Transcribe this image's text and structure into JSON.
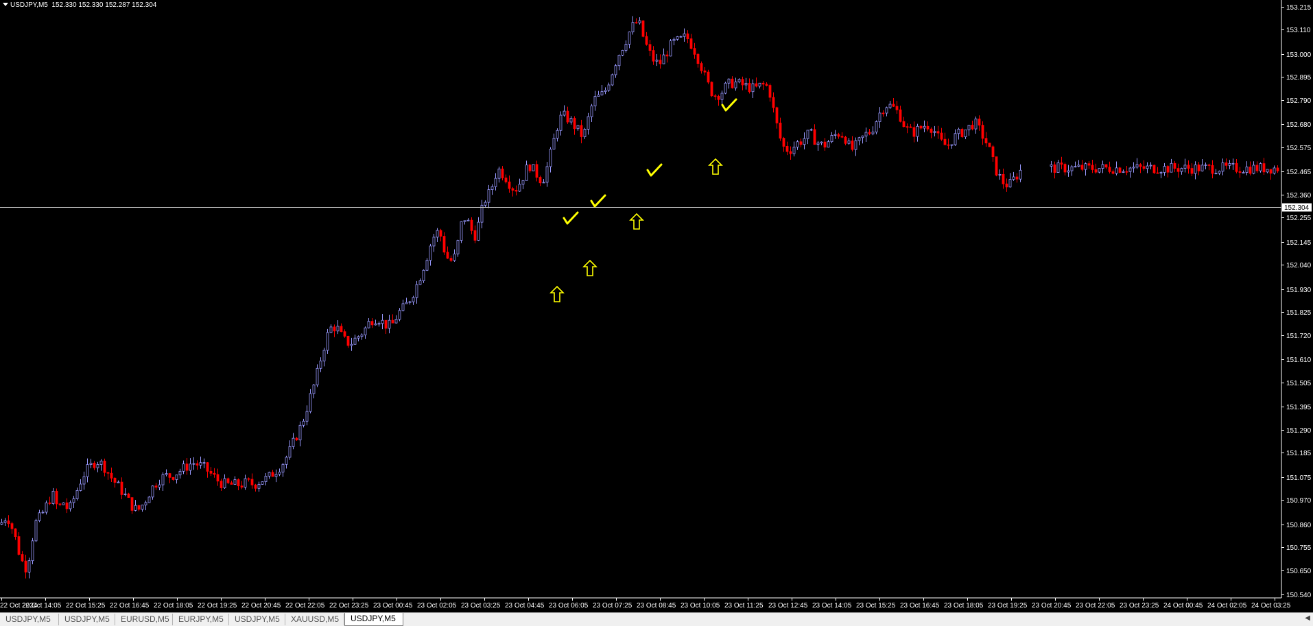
{
  "header": {
    "symbol_tf": "USDJPY,M5",
    "ohlc": "152.330 152.330 152.287 152.304"
  },
  "colors": {
    "background": "#000000",
    "bull": "#9999ff",
    "bear": "#ff0000",
    "axis": "#ffffff",
    "annotation": "#ffff00",
    "price_line": "#c0c0c0"
  },
  "chart_data": {
    "type": "candlestick",
    "symbol": "USDJPY",
    "timeframe": "M5",
    "current_price": "152.304",
    "y_ticks": [
      "153.215",
      "153.110",
      "153.000",
      "152.895",
      "152.790",
      "152.680",
      "152.575",
      "152.465",
      "152.360",
      "152.255",
      "152.145",
      "152.040",
      "151.930",
      "151.825",
      "151.720",
      "151.610",
      "151.505",
      "151.395",
      "151.290",
      "151.185",
      "151.075",
      "150.970",
      "150.860",
      "150.755",
      "150.650",
      "150.540"
    ],
    "x_ticks": [
      "22 Oct 2024",
      "22 Oct 14:05",
      "22 Oct 15:25",
      "22 Oct 16:45",
      "22 Oct 18:05",
      "22 Oct 19:25",
      "22 Oct 20:45",
      "22 Oct 22:05",
      "22 Oct 23:25",
      "23 Oct 00:45",
      "23 Oct 02:05",
      "23 Oct 03:25",
      "23 Oct 04:45",
      "23 Oct 06:05",
      "23 Oct 07:25",
      "23 Oct 08:45",
      "23 Oct 10:05",
      "23 Oct 11:25",
      "23 Oct 12:45",
      "23 Oct 14:05",
      "23 Oct 15:25",
      "23 Oct 16:45",
      "23 Oct 18:05",
      "23 Oct 19:25",
      "23 Oct 20:45",
      "23 Oct 22:05",
      "23 Oct 23:25",
      "24 Oct 00:45",
      "24 Oct 02:05",
      "24 Oct 03:25"
    ],
    "ylim": [
      150.525,
      153.245
    ],
    "path_x": [
      0,
      10,
      20,
      30,
      38,
      44,
      50,
      60,
      68,
      76,
      84,
      92,
      100,
      110,
      120,
      130,
      140,
      150,
      160,
      170,
      180,
      190,
      200,
      210,
      220,
      230,
      240,
      250,
      260,
      270,
      280,
      290,
      300,
      310,
      320,
      330,
      340,
      350,
      360,
      370,
      380,
      390,
      400,
      410,
      420,
      430,
      440,
      450,
      460,
      470,
      480,
      490,
      500,
      510,
      520,
      530,
      540,
      550,
      560,
      570,
      580,
      590,
      600,
      610,
      620,
      630,
      640,
      645,
      650,
      655,
      660,
      665,
      670,
      675,
      680,
      685,
      690,
      695,
      700,
      705,
      710,
      715,
      720,
      725,
      730,
      735,
      740,
      745,
      750,
      755,
      760,
      765,
      770,
      775,
      780,
      785,
      790,
      795,
      800,
      805,
      810,
      815,
      820,
      825,
      830,
      835,
      840,
      845,
      850,
      855,
      860,
      865,
      870,
      875,
      880,
      890,
      900,
      910,
      920,
      930,
      940,
      950,
      960,
      970,
      980,
      990,
      1000,
      1010,
      1020,
      1030,
      1040,
      1050,
      1060,
      1070,
      1080,
      1090,
      1100,
      1110,
      1120,
      1130,
      1140,
      1150,
      1160,
      1170,
      1180,
      1190,
      1200,
      1210,
      1220,
      1230,
      1240,
      1250,
      1260,
      1270,
      1280,
      1290,
      1300,
      1310,
      1320,
      1330,
      1340,
      1350,
      1360,
      1370,
      1380,
      1390,
      1400,
      1410,
      1420,
      1430,
      1440,
      1450,
      1460,
      1470,
      1480,
      1490,
      1500,
      1510,
      1520,
      1525
    ],
    "path_close": [
      150.86,
      150.9,
      150.82,
      150.7,
      150.66,
      150.74,
      150.86,
      150.9,
      150.95,
      151.0,
      150.93,
      150.96,
      150.92,
      151.0,
      151.08,
      151.12,
      151.15,
      151.13,
      151.08,
      151.04,
      151.0,
      150.95,
      150.92,
      150.96,
      151.02,
      151.06,
      151.08,
      151.08,
      151.1,
      151.12,
      151.14,
      151.13,
      151.11,
      151.08,
      151.05,
      151.04,
      151.04,
      151.04,
      151.05,
      151.04,
      151.06,
      151.07,
      151.1,
      151.13,
      151.18,
      151.25,
      151.32,
      151.42,
      151.52,
      151.65,
      151.75,
      151.76,
      151.7,
      151.68,
      151.71,
      151.74,
      151.79,
      151.8,
      151.77,
      151.76,
      151.82,
      151.85,
      151.9,
      151.97,
      152.06,
      152.16,
      152.2,
      152.13,
      152.08,
      152.06,
      152.06,
      152.1,
      152.2,
      152.26,
      152.24,
      152.22,
      152.16,
      152.2,
      152.26,
      152.33,
      152.35,
      152.38,
      152.43,
      152.48,
      152.46,
      152.45,
      152.42,
      152.4,
      152.38,
      152.4,
      152.43,
      152.46,
      152.5,
      152.48,
      152.46,
      152.44,
      152.42,
      152.46,
      152.52,
      152.58,
      152.65,
      152.7,
      152.72,
      152.71,
      152.7,
      152.68,
      152.66,
      152.64,
      152.62,
      152.68,
      152.74,
      152.79,
      152.8,
      152.81,
      152.82,
      152.9,
      152.99,
      153.05,
      153.12,
      153.15,
      153.05,
      152.98,
      152.95,
      153.0,
      153.05,
      153.06,
      153.08,
      153.03,
      152.96,
      152.87,
      152.81,
      152.82,
      152.86,
      152.87,
      152.86,
      152.85,
      152.84,
      152.86,
      152.85,
      152.7,
      152.58,
      152.56,
      152.59,
      152.61,
      152.64,
      152.6,
      152.58,
      152.61,
      152.64,
      152.63,
      152.56,
      152.59,
      152.63,
      152.65,
      152.72,
      152.77,
      152.76,
      152.73,
      152.66,
      152.64,
      152.66,
      152.68,
      152.66,
      152.6,
      152.58,
      152.62,
      152.64,
      152.66,
      152.69,
      152.64,
      152.58,
      152.48,
      152.42,
      152.4,
      152.44,
      152.48
    ]
  },
  "annotations": {
    "arrows_label": "up-arrow",
    "checks_label": "checkmark"
  },
  "tabs": [
    {
      "label": "USDJPY,M5"
    },
    {
      "label": "USDJPY,M5"
    },
    {
      "label": "EURUSD,M5"
    },
    {
      "label": "EURJPY,M5"
    },
    {
      "label": "USDJPY,M5"
    },
    {
      "label": "XAUUSD,M5"
    },
    {
      "label": "USDJPY,M5"
    }
  ]
}
